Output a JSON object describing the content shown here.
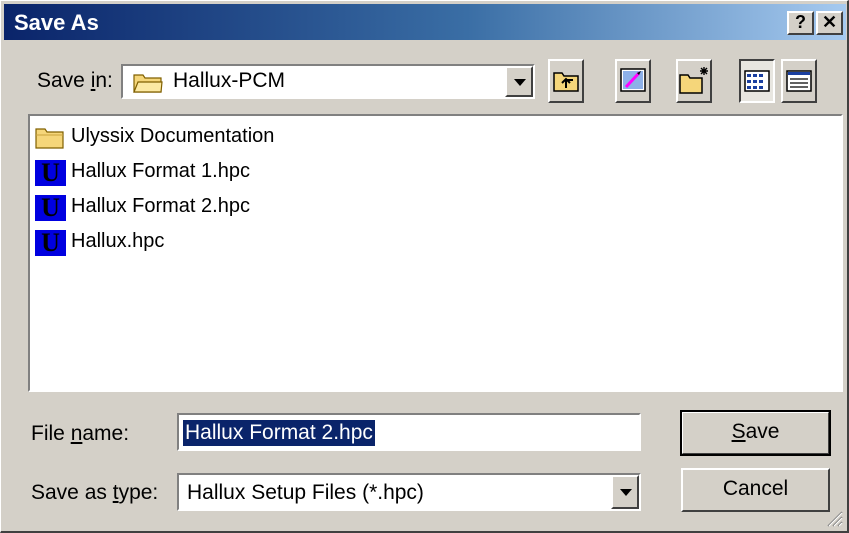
{
  "window": {
    "title": "Save As",
    "help_label": "?",
    "close_label": "✕"
  },
  "save_in": {
    "label_pre": "Save ",
    "label_mnemonic": "i",
    "label_post": "n:",
    "value": "Hallux-PCM",
    "icon": "folder-icon"
  },
  "toolbar": {
    "icons": [
      "up-one-level-icon",
      "desktop-icon",
      "new-folder-icon",
      "list-view-icon",
      "details-view-icon"
    ]
  },
  "files": [
    {
      "name": "Ulyssix Documentation",
      "icon": "folder-icon"
    },
    {
      "name": "Hallux Format 1.hpc",
      "icon": "ulyssix-file-icon",
      "glyph": "U"
    },
    {
      "name": "Hallux Format 2.hpc",
      "icon": "ulyssix-file-icon",
      "glyph": "U"
    },
    {
      "name": "Hallux.hpc",
      "icon": "ulyssix-file-icon",
      "glyph": "U"
    }
  ],
  "file_name": {
    "label_pre": "File ",
    "label_mnemonic": "n",
    "label_post": "ame:",
    "value": "Hallux Format 2.hpc"
  },
  "save_as_type": {
    "label_pre": "Save as ",
    "label_mnemonic": "t",
    "label_post": "ype:",
    "value": "Hallux Setup Files (*.hpc)"
  },
  "buttons": {
    "save_mnemonic": "S",
    "save_rest": "ave",
    "cancel": "Cancel"
  },
  "colors": {
    "title_start": "#0a246a",
    "title_end": "#a6caf0",
    "selection": "#0a246a",
    "file_icon": "#0000e0",
    "folder": "#f5d67a"
  }
}
